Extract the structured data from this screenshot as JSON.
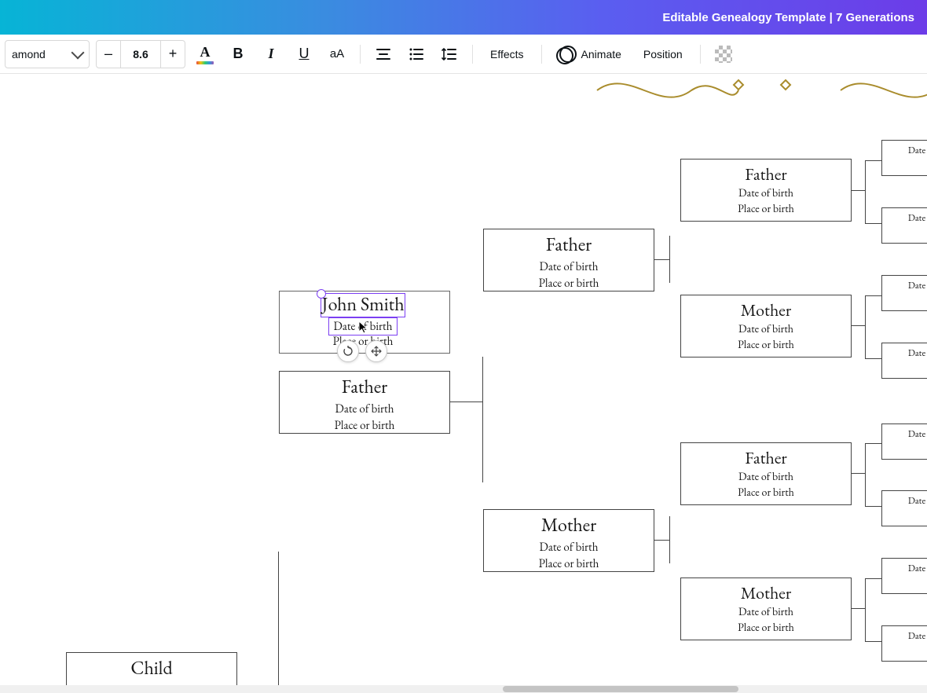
{
  "titlebar": {
    "title": "Editable Genealogy Template | 7 Generations"
  },
  "toolbar": {
    "font_name": "amond",
    "size_minus": "–",
    "size_value": "8.6",
    "size_plus": "+",
    "text_color_letter": "A",
    "bold": "B",
    "italic": "I",
    "underline": "U",
    "case": "aA",
    "effects": "Effects",
    "animate": "Animate",
    "position": "Position"
  },
  "tree": {
    "selected": {
      "name": "John Smith",
      "dob": "Date of birth",
      "place": "Place or birth"
    },
    "below_selected": {
      "name": "Father",
      "dob": "Date of birth",
      "place": "Place or birth"
    },
    "child": {
      "name": "Child"
    },
    "gen3_top": {
      "name": "Father",
      "dob": "Date of birth",
      "place": "Place or birth"
    },
    "gen3_bot": {
      "name": "Mother",
      "dob": "Date of birth",
      "place": "Place or birth"
    },
    "gen4_a": {
      "name": "Father",
      "dob": "Date of birth",
      "place": "Place or birth"
    },
    "gen4_b": {
      "name": "Mother",
      "dob": "Date of birth",
      "place": "Place or birth"
    },
    "gen4_c": {
      "name": "Father",
      "dob": "Date of birth",
      "place": "Place or birth"
    },
    "gen4_d": {
      "name": "Mother",
      "dob": "Date of birth",
      "place": "Place or birth"
    },
    "gen5_partial": "Date"
  }
}
